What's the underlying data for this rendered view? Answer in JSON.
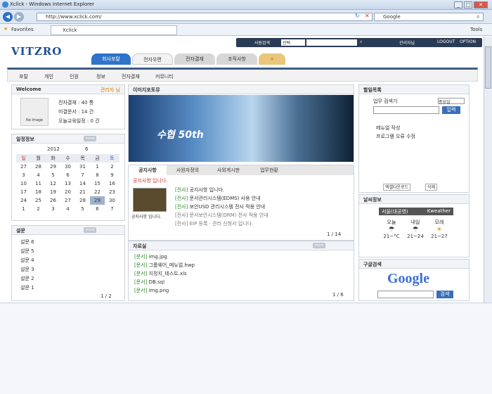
{
  "browser": {
    "title": "Xclick - Windows Internet Explorer",
    "url": "http://www.xclick.com/",
    "search": "Google",
    "favorites": "Favorites",
    "tab": "Xclick",
    "tools": "Tools"
  },
  "header": {
    "logo": "VITZRO",
    "search_label": "사원검색",
    "select": "선택",
    "topright": "관리자님",
    "logout": "LOGOUT",
    "option": "OPTION"
  },
  "tabs": [
    {
      "label": "회사포탈"
    },
    {
      "label": "전자우편"
    },
    {
      "label": "전자결재"
    },
    {
      "label": "조직사항"
    }
  ],
  "subnav": [
    "포탈",
    "개인",
    "인원",
    "정보",
    "전자결재",
    "커뮤니티"
  ],
  "welcome": {
    "title": "Welcome",
    "user": "관리자 님",
    "noimage": "No Image",
    "lines": [
      "전자결재 : 40 통",
      "미결문서 : 14 건",
      "오늘교육일정 : 0 건"
    ]
  },
  "calendar": {
    "title": "일정정보",
    "year": "2012",
    "month": "6",
    "days": [
      "일",
      "월",
      "화",
      "수",
      "목",
      "금",
      "토"
    ],
    "weeks": [
      [
        "27",
        "28",
        "29",
        "30",
        "31",
        "1",
        "2"
      ],
      [
        "3",
        "4",
        "5",
        "6",
        "7",
        "8",
        "9"
      ],
      [
        "10",
        "11",
        "12",
        "13",
        "14",
        "15",
        "16"
      ],
      [
        "17",
        "18",
        "19",
        "20",
        "21",
        "22",
        "23"
      ],
      [
        "24",
        "25",
        "26",
        "27",
        "28",
        "29",
        "30"
      ],
      [
        "1",
        "2",
        "3",
        "4",
        "5",
        "6",
        "7"
      ]
    ]
  },
  "survey": {
    "title": "설문",
    "items": [
      "설문 6",
      "설문 5",
      "설문 4",
      "설문 3",
      "설문 2",
      "설문 1"
    ],
    "page": "1 / 2"
  },
  "photo": {
    "title": "이미지포토뮤",
    "caption": "수협 50th"
  },
  "notice": {
    "tabs": [
      "공지사항",
      "사원자정의",
      "사외게시판",
      "업무현황"
    ],
    "banner": "공지사항 입니다.",
    "thumbcap": "공지사항 입니다.",
    "items": [
      {
        "tag": "[전사]",
        "text": "공지사항 입니다."
      },
      {
        "tag": "[전사]",
        "text": "문서관리시스템(EDMS) 사용 안내"
      },
      {
        "tag": "[전사]",
        "text": "보안USD 관리시스템 전사 적용 안내"
      },
      {
        "tag": "[전사]",
        "text": "문서보안시스템(DRM) 전사 적용 안내"
      },
      {
        "tag": "[전사]",
        "text": "EIP 등록 · 관리 신청서 입니다."
      }
    ],
    "page": "1 / 14"
  },
  "files": {
    "title": "자료실",
    "items": [
      {
        "tag": "[문서]",
        "name": "img.jpg"
      },
      {
        "tag": "[문서]",
        "name": "그룹웨어_메뉴얼.hwp"
      },
      {
        "tag": "[문서]",
        "name": "지정지_테스트.xls"
      },
      {
        "tag": "[문서]",
        "name": "DB.sql"
      },
      {
        "tag": "[문서]",
        "name": "img.png"
      }
    ],
    "page": "1 / 6"
  },
  "todo": {
    "title": "할일목록",
    "input_label": "업무 검색기",
    "select": "중요일",
    "btn": "입력",
    "items": [
      "메뉴얼 작성",
      "프로그램 오류 수정"
    ],
    "b1": "엑셀다운로드",
    "b2": "삭제"
  },
  "weather": {
    "title": "날씨정보",
    "city": "서울(대공영)",
    "brand": "Kweather",
    "days": [
      {
        "d": "오늘",
        "t": "21~°C"
      },
      {
        "d": "내일",
        "t": "21~24"
      },
      {
        "d": "모레",
        "t": "21~27"
      }
    ]
  },
  "google": {
    "title": "구글검색",
    "logo": "Google",
    "btn": "검색"
  }
}
